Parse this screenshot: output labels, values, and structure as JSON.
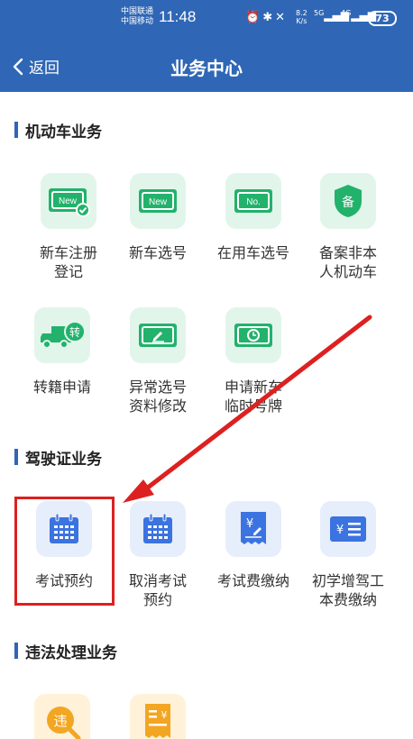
{
  "status_bar": {
    "carrier_1": "中国联通",
    "carrier_2": "中国移动",
    "time": "11:48",
    "net_speed_value": "8.2",
    "net_speed_unit": "K/s",
    "signal_1": "5G",
    "signal_2": "4G",
    "battery": "73"
  },
  "nav": {
    "back_label": "返回",
    "title": "业务中心"
  },
  "sections": [
    {
      "title": "机动车业务",
      "items": [
        {
          "label": "新车注册\n登记",
          "icon": "new-plate-check-icon",
          "badge": "New"
        },
        {
          "label": "新车选号",
          "icon": "new-plate-icon",
          "badge": "New"
        },
        {
          "label": "在用车选号",
          "icon": "number-plate-icon",
          "badge": "No."
        },
        {
          "label": "备案非本\n人机动车",
          "icon": "filing-shield-icon",
          "badge": "备"
        },
        {
          "label": "转籍申请",
          "icon": "truck-transfer-icon",
          "badge": "转"
        },
        {
          "label": "异常选号\n资料修改",
          "icon": "plate-edit-icon"
        },
        {
          "label": "申请新车\n临时号牌",
          "icon": "temp-plate-clock-icon"
        }
      ]
    },
    {
      "title": "驾驶证业务",
      "items": [
        {
          "label": "考试预约",
          "icon": "calendar-icon"
        },
        {
          "label": "取消考试\n预约",
          "icon": "calendar-cancel-icon"
        },
        {
          "label": "考试费缴纳",
          "icon": "fee-receipt-icon",
          "badge": "¥"
        },
        {
          "label": "初学增驾工\n本费缴纳",
          "icon": "fee-card-icon",
          "badge": "¥"
        }
      ]
    },
    {
      "title": "违法处理业务",
      "items": [
        {
          "icon": "violation-search-icon",
          "badge": "违"
        },
        {
          "icon": "fine-receipt-icon",
          "badge": "¥"
        }
      ]
    }
  ],
  "colors": {
    "header": "#2f67b6",
    "green_icon": "#22b26b",
    "blue_icon": "#3b73e0",
    "orange_icon": "#f2a622",
    "annotation": "#dd2020"
  }
}
